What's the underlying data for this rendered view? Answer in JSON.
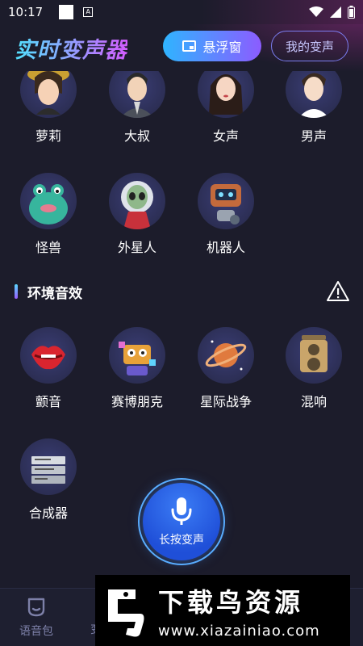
{
  "status_bar": {
    "time": "10:17",
    "notif_letter": "A"
  },
  "header": {
    "title": "实时变声器",
    "float_button": "悬浮窗",
    "mine_button": "我的变声"
  },
  "voice_presets": [
    {
      "label": "萝莉",
      "icon": "girl-avatar"
    },
    {
      "label": "大叔",
      "icon": "uncle-avatar"
    },
    {
      "label": "女声",
      "icon": "woman-avatar"
    },
    {
      "label": "男声",
      "icon": "man-avatar"
    },
    {
      "label": "怪兽",
      "icon": "monster-avatar"
    },
    {
      "label": "外星人",
      "icon": "alien-avatar"
    },
    {
      "label": "机器人",
      "icon": "robot-avatar"
    }
  ],
  "environment": {
    "section_title": "环境音效",
    "items": [
      {
        "label": "颤音",
        "icon": "lips-icon"
      },
      {
        "label": "赛博朋克",
        "icon": "cyberpunk-icon"
      },
      {
        "label": "星际战争",
        "icon": "planet-icon"
      },
      {
        "label": "混响",
        "icon": "speaker-icon"
      },
      {
        "label": "合成器",
        "icon": "synthesizer-icon"
      }
    ]
  },
  "mic_button": {
    "label": "长按变声"
  },
  "bottom_nav": {
    "item1": "语音包",
    "item2_partial": "变"
  },
  "watermark": {
    "brand": "下载鸟资源",
    "url": "www.xiazainiao.com"
  },
  "colors": {
    "bg": "#1c1c2b",
    "accent_blue": "#2fb4ff",
    "accent_purple": "#8c5cff"
  }
}
